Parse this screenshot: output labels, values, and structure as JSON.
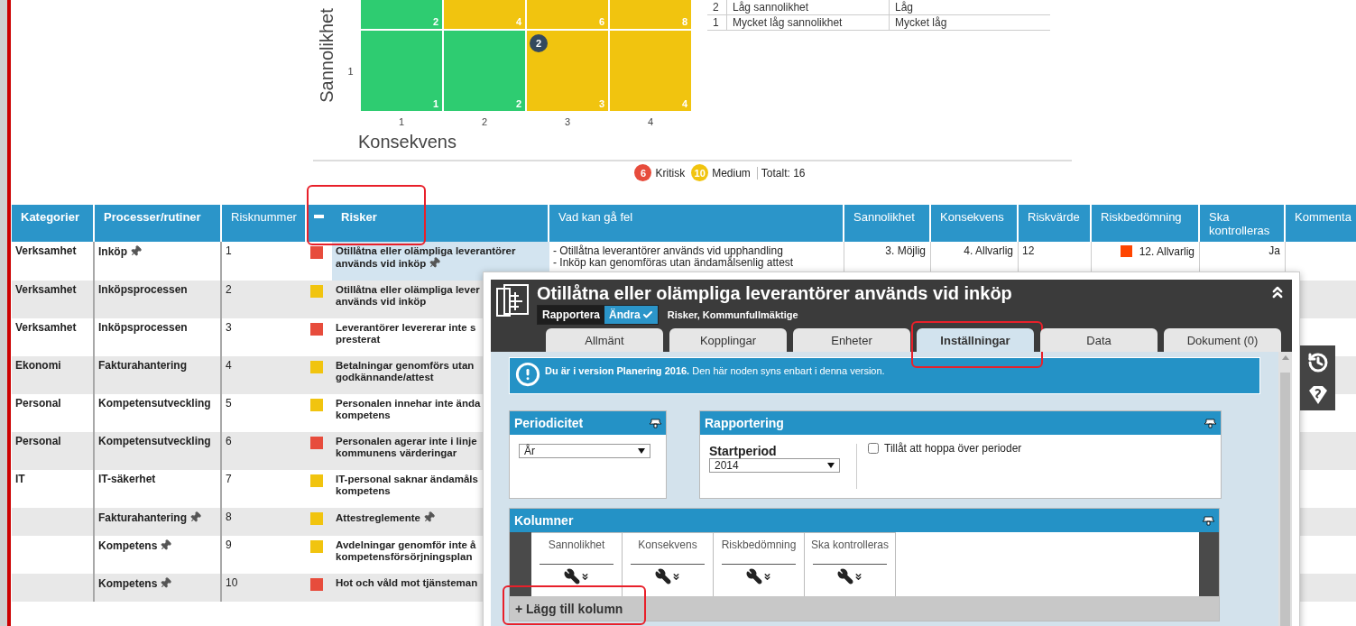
{
  "matrix": {
    "y_label": "Sannolikhet",
    "x_label": "Konsekvens",
    "x_ticks": [
      "1",
      "2",
      "3",
      "4"
    ],
    "rows": [
      {
        "cells": [
          {
            "value": "2",
            "color": "#2ecc71"
          },
          {
            "value": "4",
            "color": "#f1c40f"
          },
          {
            "value": "6",
            "color": "#f1c40f"
          },
          {
            "value": "8",
            "color": "#f1c40f"
          }
        ]
      },
      {
        "tick": "1",
        "cells": [
          {
            "value": "1",
            "color": "#2ecc71"
          },
          {
            "value": "2",
            "color": "#2ecc71"
          },
          {
            "value": "3",
            "color": "#f1c40f",
            "badge": "2"
          },
          {
            "value": "4",
            "color": "#f1c40f"
          }
        ]
      }
    ]
  },
  "legend": [
    {
      "level": "2",
      "name": "Låg sannolikhet",
      "short": "Låg"
    },
    {
      "level": "1",
      "name": "Mycket låg sannolikhet",
      "short": "Mycket låg"
    }
  ],
  "summary": {
    "counts": [
      {
        "count": "6",
        "label": "Kritisk",
        "color": "#e74c3c"
      },
      {
        "count": "10",
        "label": "Medium",
        "color": "#f1c40f"
      }
    ],
    "total": "Totalt: 16"
  },
  "table": {
    "columns": [
      {
        "kind": "text",
        "label": "Kategorier",
        "bold": true,
        "highlighted": false
      },
      {
        "kind": "text",
        "label": "Processer/rutiner",
        "bold": true,
        "highlighted": false
      },
      {
        "kind": "text",
        "label": "Risknummer",
        "bold": false,
        "highlighted": false
      },
      {
        "kind": "toggle"
      },
      {
        "kind": "text",
        "label": "Risker",
        "bold": true,
        "highlighted": true
      },
      {
        "kind": "text",
        "label": "Vad kan gå fel",
        "bold": false,
        "highlighted": false
      },
      {
        "kind": "text",
        "label": "Sannolikhet",
        "bold": false,
        "highlighted": false
      },
      {
        "kind": "text",
        "label": "Konsekvens",
        "bold": false,
        "highlighted": false
      },
      {
        "kind": "text",
        "label": "Riskvärde",
        "bold": false,
        "highlighted": false
      },
      {
        "kind": "text",
        "label": "Riskbedömning",
        "bold": false,
        "highlighted": false
      },
      {
        "kind": "text",
        "label": "Ska kontrolleras",
        "bold": false,
        "highlighted": false
      },
      {
        "kind": "text",
        "label": "Kommenta",
        "bold": false,
        "highlighted": false
      }
    ],
    "rows": [
      {
        "category": "Verksamhet",
        "process": "Inköp",
        "process_pinned": true,
        "number": "1",
        "status": {
          "color": "#e74c3c"
        },
        "risk": "Otillåtna eller olämpliga leverantörer\nanvänds vid inköp",
        "risk_pinned": true,
        "selected": true,
        "what": "- Otillåtna leverantörer används vid upphandling\n- Inköp kan genomföras utan ändamålsenlig attest",
        "probability": "3. Möjlig",
        "consequence": "4. Allvarlig",
        "value": "12",
        "assessment": {
          "label": "12. Allvarlig",
          "color": "#ff4500"
        },
        "control": "Ja"
      },
      {
        "category": "Verksamhet",
        "process": "Inköpsprocessen",
        "process_pinned": false,
        "number": "2",
        "status": {
          "color": "#f1c40f"
        },
        "risk": "Otillåtna eller olämpliga lever\nanvänds vid inköp",
        "risk_pinned": false,
        "selected": false
      },
      {
        "category": "Verksamhet",
        "process": "Inköpsprocessen",
        "process_pinned": false,
        "number": "3",
        "status": {
          "color": "#e74c3c"
        },
        "risk": "Leverantörer levererar inte s\npresterat",
        "risk_pinned": false,
        "selected": false
      },
      {
        "category": "Ekonomi",
        "process": "Fakturahantering",
        "process_pinned": false,
        "number": "4",
        "status": {
          "color": "#f1c40f"
        },
        "risk": "Betalningar genomförs utan\ngodkännande/attest",
        "risk_pinned": false,
        "selected": false
      },
      {
        "category": "Personal",
        "process": "Kompetensutveckling",
        "process_pinned": false,
        "number": "5",
        "status": {
          "color": "#f1c40f"
        },
        "risk": "Personalen innehar inte ända\nkompetens",
        "risk_pinned": false,
        "selected": false
      },
      {
        "category": "Personal",
        "process": "Kompetensutveckling",
        "process_pinned": false,
        "number": "6",
        "status": {
          "color": "#e74c3c"
        },
        "risk": "Personalen agerar inte i linje\nkommunens värderingar",
        "risk_pinned": false,
        "selected": false
      },
      {
        "category": "IT",
        "process": "IT-säkerhet",
        "process_pinned": false,
        "number": "7",
        "status": {
          "color": "#f1c40f"
        },
        "risk": "IT-personal saknar ändamåls\nkompetens",
        "risk_pinned": false,
        "selected": false
      },
      {
        "process": "Fakturahantering",
        "process_pinned": true,
        "number": "8",
        "status": {
          "color": "#f1c40f"
        },
        "risk": "Attestreglemente",
        "risk_pinned": true,
        "selected": false
      },
      {
        "process": "Kompetens",
        "process_pinned": true,
        "number": "9",
        "status": {
          "color": "#f1c40f"
        },
        "risk": "Avdelningar genomför inte å\nkompetensförsörjningsplan",
        "risk_pinned": false,
        "selected": false
      },
      {
        "process": "Kompetens",
        "process_pinned": true,
        "number": "10",
        "status": {
          "color": "#e74c3c"
        },
        "risk": "Hot och våld mot tjänsteman",
        "risk_pinned": false,
        "selected": false
      }
    ]
  },
  "popup": {
    "title": "Otillåtna eller olämpliga leverantörer används vid inköp",
    "actions": [
      {
        "kind": "report",
        "label": "Rapportera"
      },
      {
        "kind": "edit",
        "label": "Ändra"
      }
    ],
    "breadcrumb": "Risker, Kommunfullmäktige",
    "tabs": [
      {
        "label": "Allmänt",
        "selected": false,
        "highlighted": false
      },
      {
        "label": "Kopplingar",
        "selected": false,
        "highlighted": false
      },
      {
        "label": "Enheter",
        "selected": false,
        "highlighted": false
      },
      {
        "label": "Inställningar",
        "selected": true,
        "highlighted": true
      },
      {
        "label": "Data",
        "selected": false,
        "highlighted": false
      },
      {
        "label": "Dokument (0)",
        "selected": false,
        "highlighted": false
      }
    ],
    "notice": "**Du är i version Planering 2016.** Den här noden syns enbart i denna version.",
    "periodicity": {
      "title": "Periodicitet",
      "value": "År"
    },
    "reporting": {
      "title": "Rapportering",
      "start_label": "Startperiod",
      "start_value": "2014",
      "skip_label": "Tillåt att hoppa över perioder",
      "skip_checked": false
    },
    "columns_panel": {
      "title": "Kolumner",
      "columns": [
        "Sannolikhet",
        "Konsekvens",
        "Riskbedömning",
        "Ska kontrolleras"
      ],
      "add_label": "+ Lägg till kolumn",
      "add_highlighted": true
    }
  }
}
